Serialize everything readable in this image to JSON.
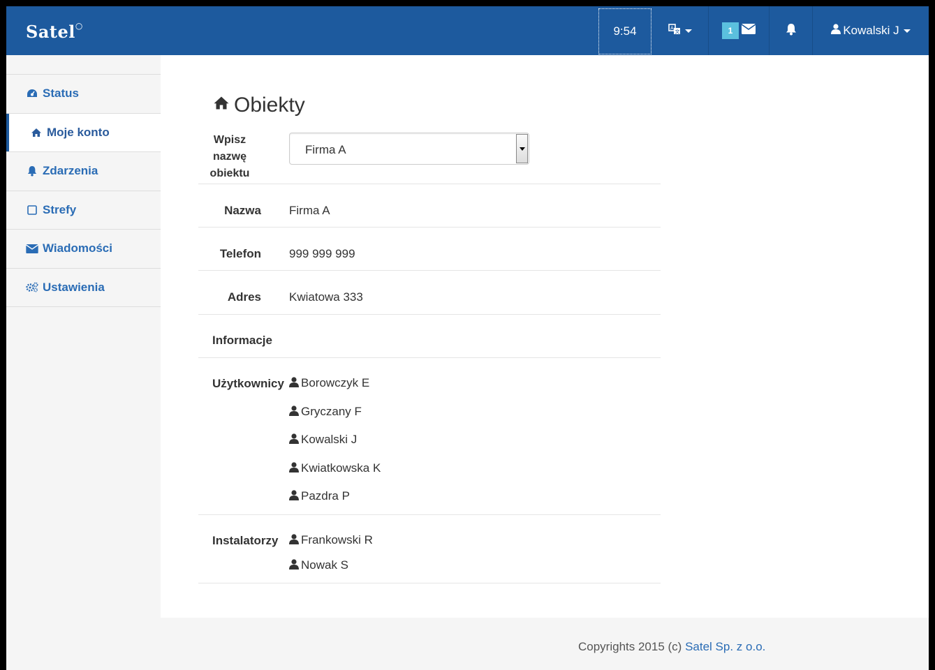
{
  "navbar": {
    "brand": "Satel",
    "clock": "9:54",
    "message_count": "1",
    "user_name": "Kowalski J",
    "colors": {
      "navbar_bg": "#1d5a9e",
      "badge": "#5bc0de"
    },
    "icons": [
      "language-icon",
      "envelope-icon",
      "bell-icon",
      "user-icon"
    ]
  },
  "sidebar": {
    "items": [
      {
        "label": "Status",
        "icon": "dashboard-icon",
        "active": false
      },
      {
        "label": "Moje konto",
        "icon": "home-icon",
        "active": true
      },
      {
        "label": "Zdarzenia",
        "icon": "bell-icon",
        "active": false
      },
      {
        "label": "Strefy",
        "icon": "square-icon",
        "active": false
      },
      {
        "label": "Wiadomości",
        "icon": "envelope-icon",
        "active": false
      },
      {
        "label": "Ustawienia",
        "icon": "gears-icon",
        "active": false
      }
    ]
  },
  "main": {
    "title": "Obiekty",
    "object_select": {
      "label": "Wpisz nazwę obiektu",
      "label_lines": [
        "Wpisz",
        "nazwę",
        "obiektu"
      ],
      "selected": "Firma A"
    },
    "fields": {
      "name_label": "Nazwa",
      "name_value": "Firma A",
      "phone_label": "Telefon",
      "phone_value": "999 999 999",
      "address_label": "Adres",
      "address_value": "Kwiatowa 333",
      "info_label": "Informacje"
    },
    "users_label": "Użytkownicy",
    "users": [
      "Borowczyk E",
      "Gryczany F",
      "Kowalski J",
      "Kwiatkowska K",
      "Pazdra P"
    ],
    "installers_label": "Instalatorzy",
    "installers": [
      "Frankowski R",
      "Nowak S"
    ]
  },
  "footer": {
    "text": "Copyrights 2015 (c) ",
    "link": "Satel Sp. z o.o."
  }
}
